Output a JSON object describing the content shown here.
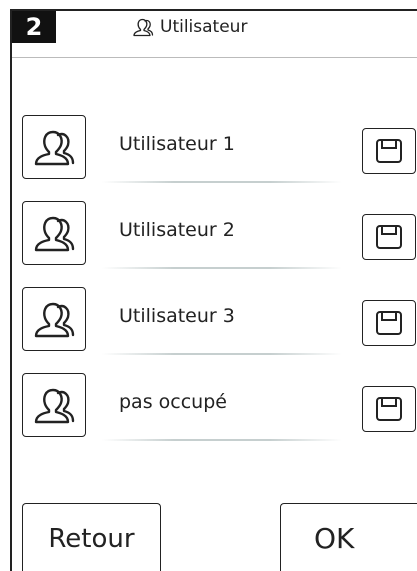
{
  "header": {
    "number": "2",
    "title": "Utilisateur",
    "title_icon": "user-group-icon"
  },
  "users": [
    {
      "label": "Utilisateur 1",
      "icon": "user-group-icon",
      "action_icon": "save-icon"
    },
    {
      "label": "Utilisateur 2",
      "icon": "user-group-icon",
      "action_icon": "save-icon"
    },
    {
      "label": "Utilisateur 3",
      "icon": "user-group-icon",
      "action_icon": "save-icon"
    },
    {
      "label": "pas occupé",
      "icon": "user-group-icon",
      "action_icon": "save-icon"
    }
  ],
  "footer": {
    "back_label": "Retour",
    "ok_label": "OK"
  }
}
